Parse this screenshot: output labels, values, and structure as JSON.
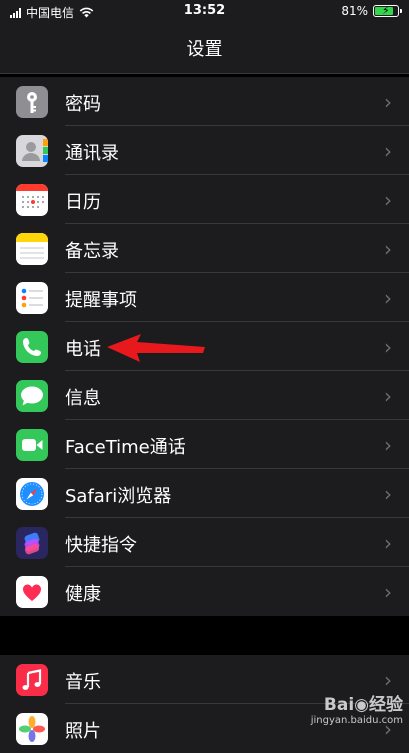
{
  "status": {
    "carrier": "中国电信",
    "time": "13:52",
    "battery": "81%",
    "battery_level": 0.81
  },
  "nav": {
    "title": "设置"
  },
  "group1": [
    {
      "label": "密码",
      "icon": "key-icon"
    },
    {
      "label": "通讯录",
      "icon": "contacts-icon"
    },
    {
      "label": "日历",
      "icon": "calendar-icon"
    },
    {
      "label": "备忘录",
      "icon": "notes-icon"
    },
    {
      "label": "提醒事项",
      "icon": "reminders-icon"
    },
    {
      "label": "电话",
      "icon": "phone-icon"
    },
    {
      "label": "信息",
      "icon": "messages-icon"
    },
    {
      "label": "FaceTime通话",
      "icon": "facetime-icon"
    },
    {
      "label": "Safari浏览器",
      "icon": "safari-icon"
    },
    {
      "label": "快捷指令",
      "icon": "shortcuts-icon"
    },
    {
      "label": "健康",
      "icon": "health-icon"
    }
  ],
  "group2": [
    {
      "label": "音乐",
      "icon": "music-icon"
    },
    {
      "label": "照片",
      "icon": "photos-icon"
    }
  ],
  "chevron": "›",
  "watermark": {
    "brand": "Bai◉经验",
    "site": "jingyan.baidu.com"
  }
}
